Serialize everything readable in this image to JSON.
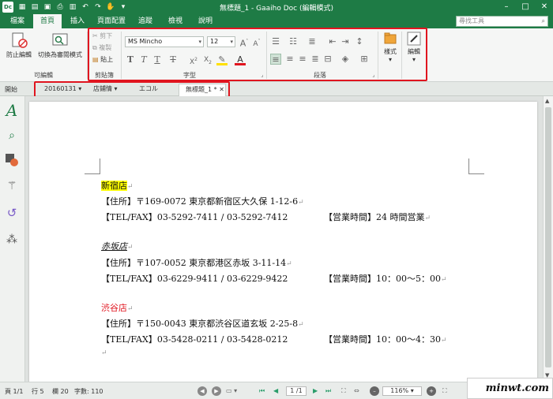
{
  "window": {
    "app_icon": "Dc",
    "title": "無標題_1 - Gaaiho Doc (編輯模式)",
    "controls": [
      "minimize-icon",
      "maximize-icon",
      "close-icon"
    ]
  },
  "menu_tabs": [
    "檔案",
    "首頁",
    "插入",
    "頁面配置",
    "追蹤",
    "檢視",
    "說明"
  ],
  "active_tab": "首頁",
  "search": {
    "placeholder": "尋找工具"
  },
  "ribbon": {
    "editable_group": {
      "label": "可編輯",
      "stop_edit": "防止編輯",
      "switch_read": "切換為審閱模式"
    },
    "clipboard_group": {
      "label": "剪貼簿",
      "cut": "剪下",
      "copy": "複製",
      "paste": "貼上"
    },
    "font_group": {
      "label": "字型",
      "font_name": "MS Mincho",
      "font_size": "12"
    },
    "paragraph_group": {
      "label": "段落"
    },
    "style_group": {
      "label": "樣式"
    },
    "edit_group": {
      "label": "編輯"
    }
  },
  "start_label": "開始",
  "doc_tabs": [
    "20160131",
    "店鋪情",
    "エコル",
    "無標題_1 *"
  ],
  "document": {
    "stores": [
      {
        "name": "新宿店",
        "address": "【住所】〒169-0072 東京都新宿区大久保 1-12-6",
        "tel": "【TEL/FAX】03-5292-7411 / 03-5292-7412",
        "hours": "【営業時間】24 時間営業"
      },
      {
        "name": "赤坂店",
        "address": "【住所】〒107-0052 東京都港区赤坂 3-11-14",
        "tel": "【TEL/FAX】03-6229-9411 / 03-6229-9422",
        "hours": "【営業時間】10：00〜5：00"
      },
      {
        "name": "渋谷店",
        "address": "【住所】〒150-0043 東京都渋谷区道玄坂 2-25-8",
        "tel": "【TEL/FAX】03-5428-0211 / 03-5428-0212",
        "hours": "【営業時間】10：00〜4：30"
      }
    ],
    "paragraph_mark": "↵"
  },
  "status": {
    "page": "頁 1/1",
    "line": "行 5",
    "col": "欄 20",
    "chars": "字數: 110",
    "page_nav": "1 /1",
    "zoom": "116%"
  },
  "watermark": "minwt.com",
  "colors": {
    "brand": "#1e7b45",
    "highlight": "#ffff00",
    "red_text": "#e0151f",
    "annotation": "#e0151f"
  }
}
